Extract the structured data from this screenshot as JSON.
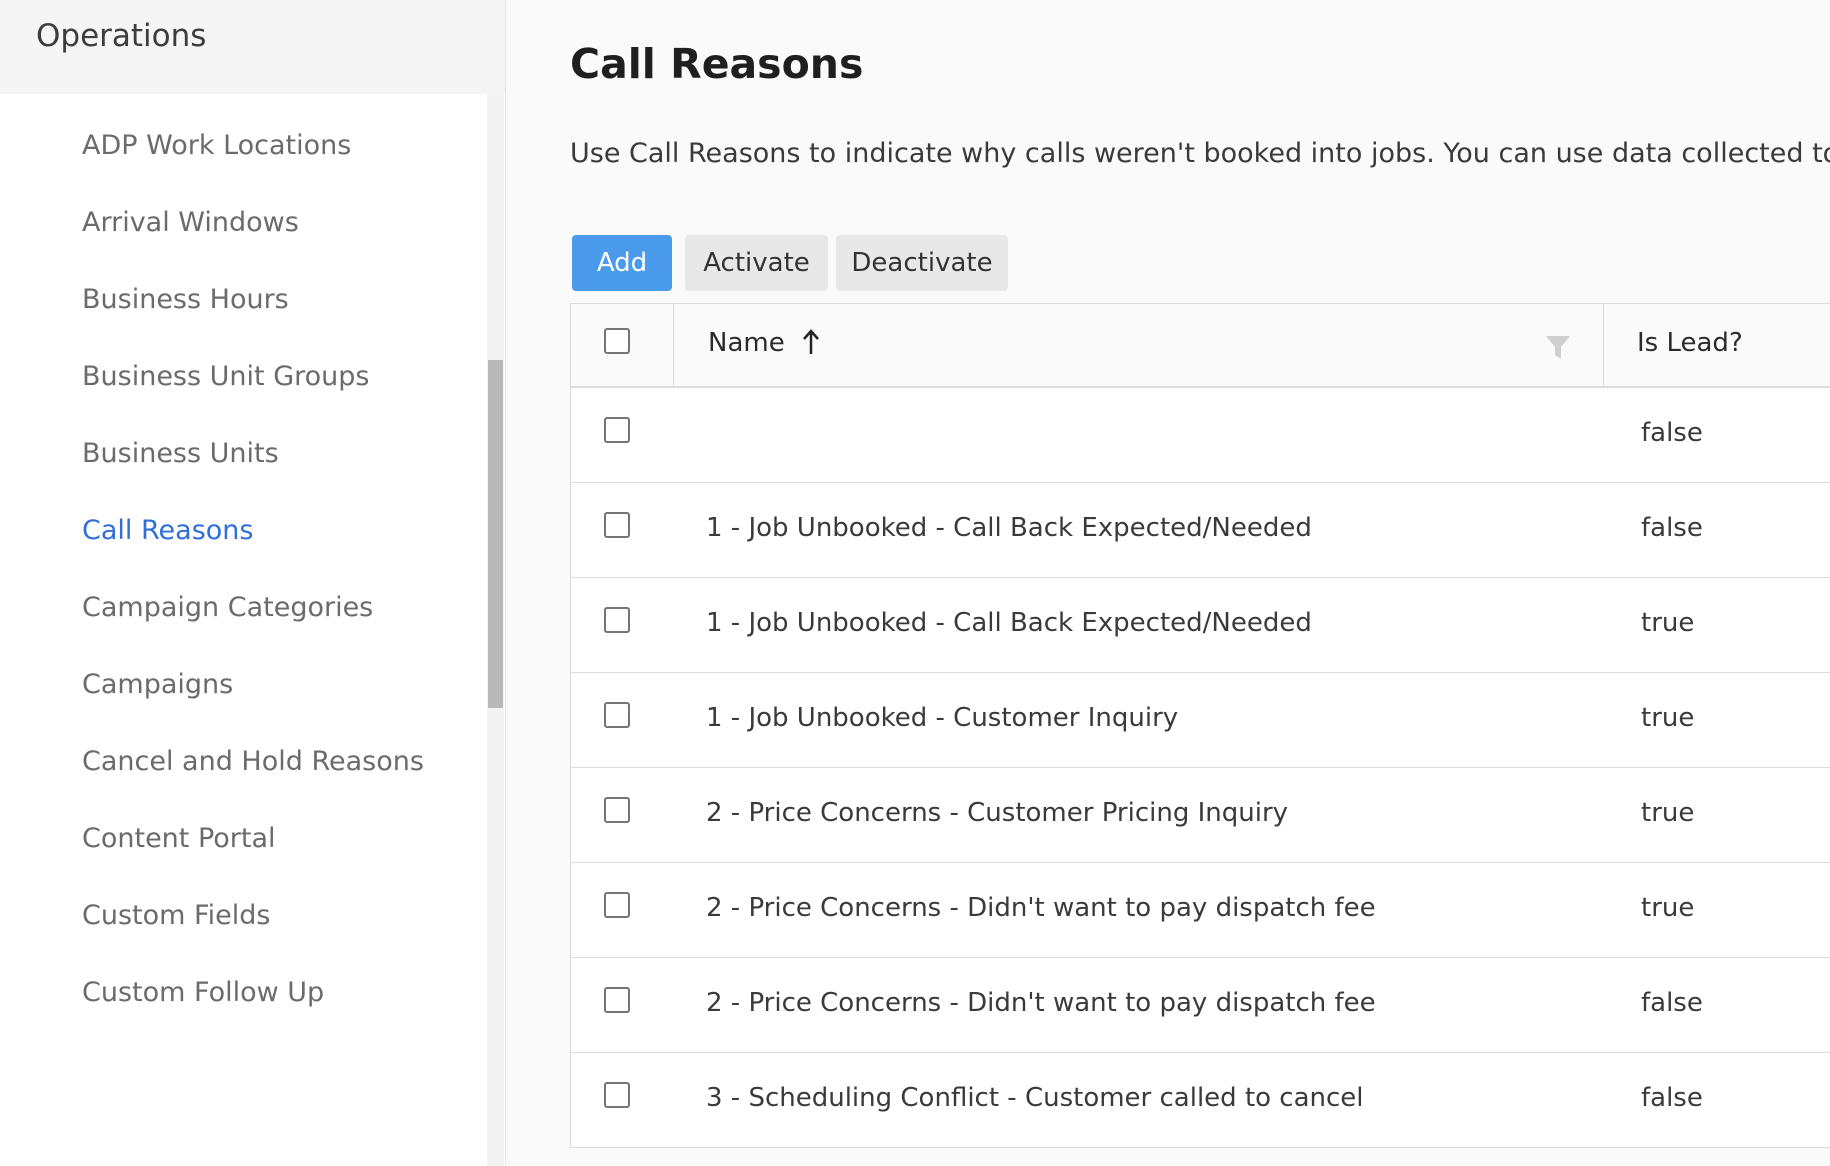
{
  "sidebar": {
    "header": "Operations",
    "items": [
      {
        "label": "ADP Work Locations",
        "active": false
      },
      {
        "label": "Arrival Windows",
        "active": false
      },
      {
        "label": "Business Hours",
        "active": false
      },
      {
        "label": "Business Unit Groups",
        "active": false
      },
      {
        "label": "Business Units",
        "active": false
      },
      {
        "label": "Call Reasons",
        "active": true
      },
      {
        "label": "Campaign Categories",
        "active": false
      },
      {
        "label": "Campaigns",
        "active": false
      },
      {
        "label": "Cancel and Hold Reasons",
        "active": false
      },
      {
        "label": "Content Portal",
        "active": false
      },
      {
        "label": "Custom Fields",
        "active": false
      },
      {
        "label": "Custom Follow Up",
        "active": false
      }
    ]
  },
  "main": {
    "title": "Call Reasons",
    "description": "Use Call Reasons to indicate why calls weren't booked into jobs. You can use data collected to genera",
    "toolbar": {
      "add_label": "Add",
      "activate_label": "Activate",
      "deactivate_label": "Deactivate"
    },
    "table": {
      "columns": {
        "name": "Name",
        "is_lead": "Is Lead?"
      },
      "sort": "ascending",
      "rows": [
        {
          "name": "",
          "is_lead": "false"
        },
        {
          "name": "1 - Job Unbooked - Call Back Expected/Needed",
          "is_lead": "false"
        },
        {
          "name": "1 - Job Unbooked - Call Back Expected/Needed",
          "is_lead": "true"
        },
        {
          "name": "1 - Job Unbooked - Customer Inquiry",
          "is_lead": "true"
        },
        {
          "name": "2 - Price Concerns - Customer Pricing Inquiry",
          "is_lead": "true"
        },
        {
          "name": "2 - Price Concerns - Didn't want to pay dispatch fee",
          "is_lead": "true"
        },
        {
          "name": "2 - Price Concerns - Didn't want to pay dispatch fee",
          "is_lead": "false"
        },
        {
          "name": "3 - Scheduling Conflict - Customer called to cancel",
          "is_lead": "false"
        }
      ]
    }
  },
  "colors": {
    "accent": "#4a9bec",
    "active_link": "#2f6fd9"
  }
}
